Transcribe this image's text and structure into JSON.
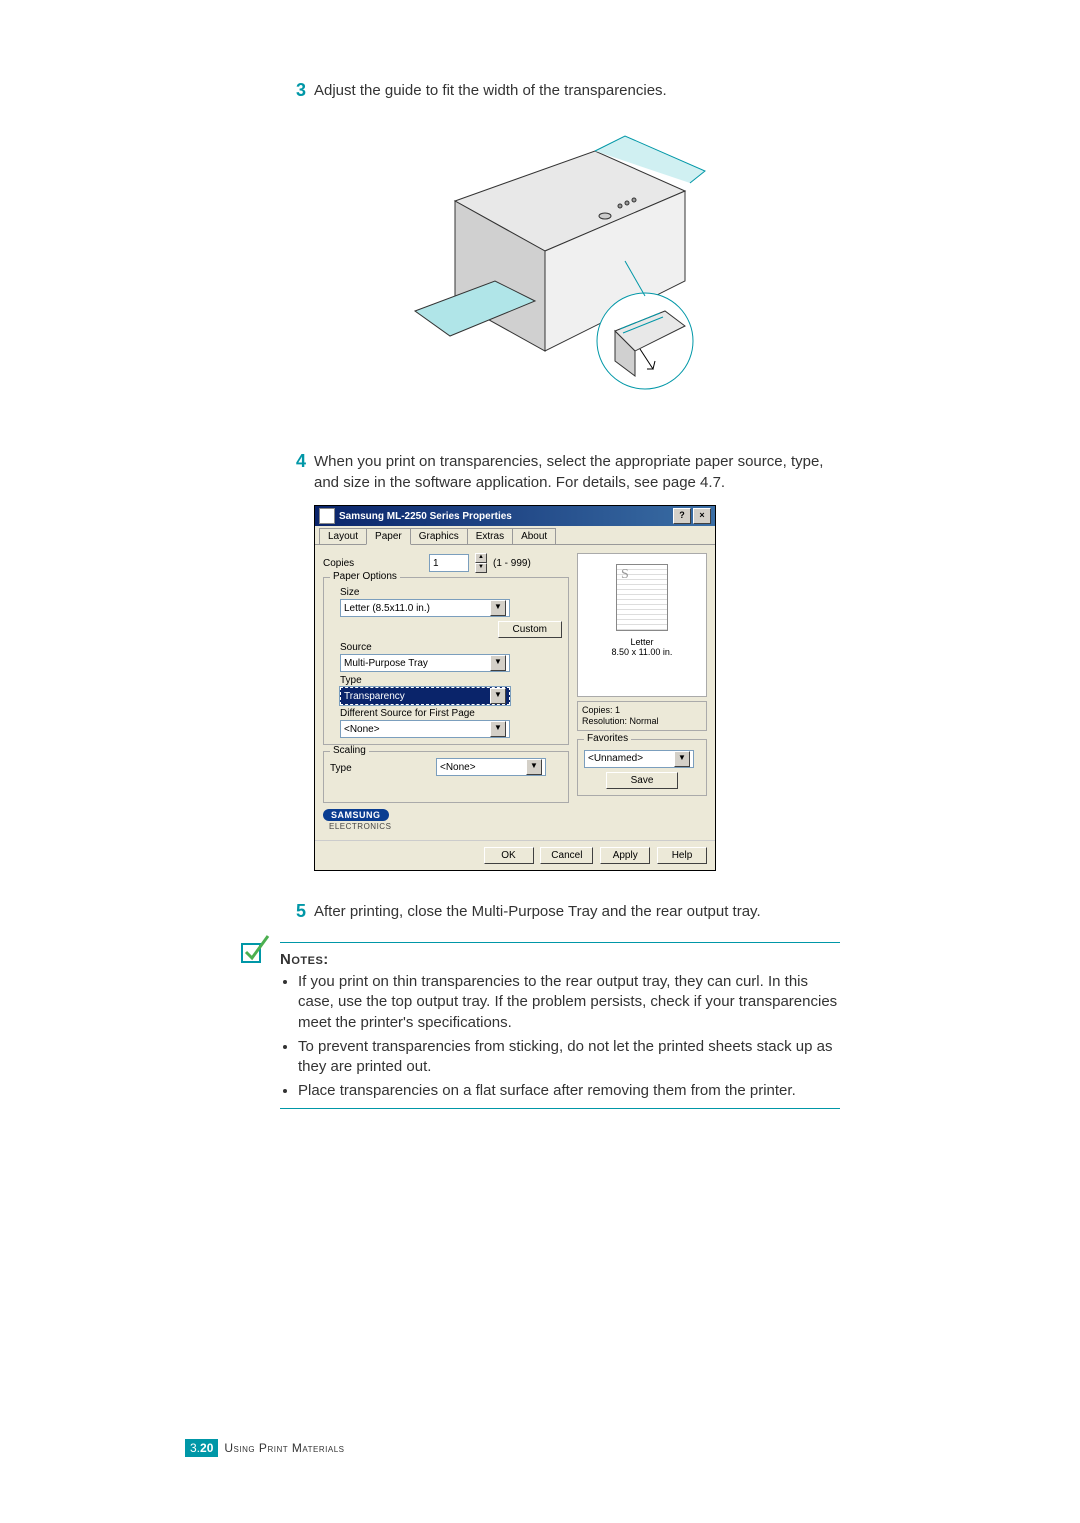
{
  "steps": {
    "s3": {
      "num": "3",
      "text": "Adjust the guide to fit the width of the transparencies."
    },
    "s4": {
      "num": "4",
      "text": "When you print on transparencies, select the appropriate paper source, type, and size in the software application. For details, see page 4.7."
    },
    "s5": {
      "num": "5",
      "text": "After printing, close the Multi-Purpose Tray and the rear output tray."
    }
  },
  "dialog": {
    "title": "Samsung ML-2250 Series Properties",
    "help_btn": "?",
    "close_btn": "×",
    "tabs": [
      "Layout",
      "Paper",
      "Graphics",
      "Extras",
      "About"
    ],
    "copies_label": "Copies",
    "copies_value": "1",
    "copies_range": "(1 - 999)",
    "paper_options": "Paper Options",
    "size_label": "Size",
    "size_value": "Letter (8.5x11.0 in.)",
    "custom_btn": "Custom",
    "source_label": "Source",
    "source_value": "Multi-Purpose Tray",
    "type_label": "Type",
    "type_value": "Transparency",
    "diff_label": "Different Source for First Page",
    "diff_value": "<None>",
    "scaling": "Scaling",
    "scaling_type_label": "Type",
    "scaling_value": "<None>",
    "preview_paper": "Letter",
    "preview_dims": "8.50 x 11.00 in.",
    "info_copies": "Copies: 1",
    "info_res": "Resolution: Normal",
    "favorites": "Favorites",
    "fav_value": "<Unnamed>",
    "save_btn": "Save",
    "logo": "SAMSUNG",
    "elec": "ELECTRONICS",
    "ok": "OK",
    "cancel": "Cancel",
    "apply": "Apply",
    "help": "Help"
  },
  "notes": {
    "title": "Notes:",
    "items": [
      "If you print on thin transparencies to the rear output tray, they can curl. In this case, use the top output tray. If the problem persists, check if your transparencies meet the printer's specifications.",
      "To prevent transparencies from sticking, do not let the printed sheets stack up as they are printed out.",
      "Place transparencies on a flat surface after removing them from the printer."
    ]
  },
  "footer": {
    "chapter": "3.",
    "page": "20",
    "section": "Using Print Materials"
  }
}
